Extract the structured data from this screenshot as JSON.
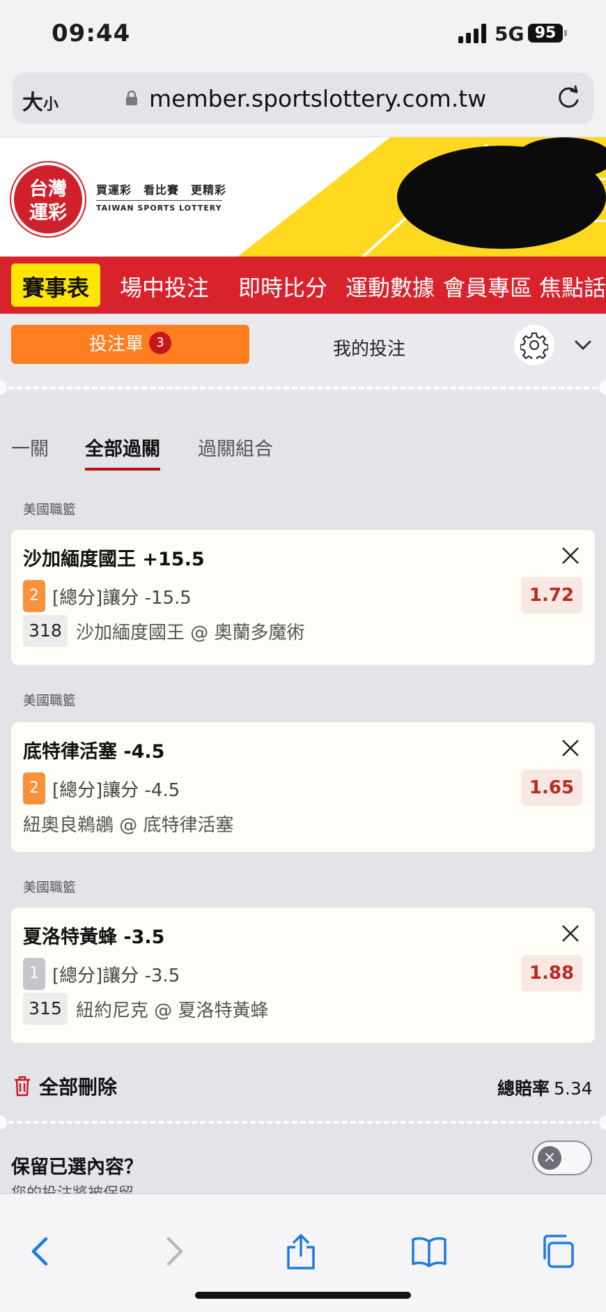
{
  "status_bar": {
    "time": "09:44",
    "network": "5G",
    "battery": "95"
  },
  "address_bar": {
    "text_size_label": "大",
    "text_size_small": "小",
    "url": "member.sportslottery.com.tw"
  },
  "banner": {
    "logo_text_line1": "台灣",
    "logo_text_line2": "運彩",
    "slogan": "買運彩　看比賽　更精彩",
    "slogan_en": "TAIWAN SPORTS LOTTERY"
  },
  "nav": {
    "items": [
      "賽事表",
      "場中投注",
      "即時比分",
      "運動數據",
      "會員專區",
      "焦點話"
    ]
  },
  "tabs": {
    "betslip_label": "投注單",
    "betslip_count": "3",
    "mybets_label": "我的投注"
  },
  "subtabs": [
    "一關",
    "全部過關",
    "過關組合"
  ],
  "bets": [
    {
      "league": "美國職籃",
      "selection": "沙加緬度國王 +15.5",
      "badge": "2",
      "badge_color": "#f9903a",
      "market": "[總分]讓分 -15.5",
      "game_no": "318",
      "match": "沙加緬度國王 @ 奧蘭多魔術",
      "odds": "1.72"
    },
    {
      "league": "美國職籃",
      "selection": "底特律活塞 -4.5",
      "badge": "2",
      "badge_color": "#f9903a",
      "market": "[總分]讓分 -4.5",
      "game_no": "",
      "match": "紐奧良鵜鶘 @ 底特律活塞",
      "odds": "1.65"
    },
    {
      "league": "美國職籃",
      "selection": "夏洛特黃蜂 -3.5",
      "badge": "1",
      "badge_color": "#c5c6cc",
      "market": "[總分]讓分 -3.5",
      "game_no": "315",
      "match": "紐約尼克 @ 夏洛特黃蜂",
      "odds": "1.88"
    }
  ],
  "footer": {
    "delete_all": "全部刪除",
    "total_odds_label": "總賠率",
    "total_odds_value": "5.34"
  },
  "keep": {
    "title": "保留已選內容？",
    "subtitle": "您的投注將被保留",
    "toggle_icon": "×"
  },
  "colors": {
    "accent_orange": "#ff7e1f",
    "brand_red": "#d8222c",
    "nav_active": "#ffe500",
    "odds_red": "#b82a22"
  },
  "icons": [
    "lock-icon",
    "reload-icon",
    "gear-icon",
    "chevron-down-icon",
    "close-icon",
    "trash-icon",
    "back-icon",
    "forward-icon",
    "share-icon",
    "bookmarks-icon",
    "tabs-icon"
  ]
}
